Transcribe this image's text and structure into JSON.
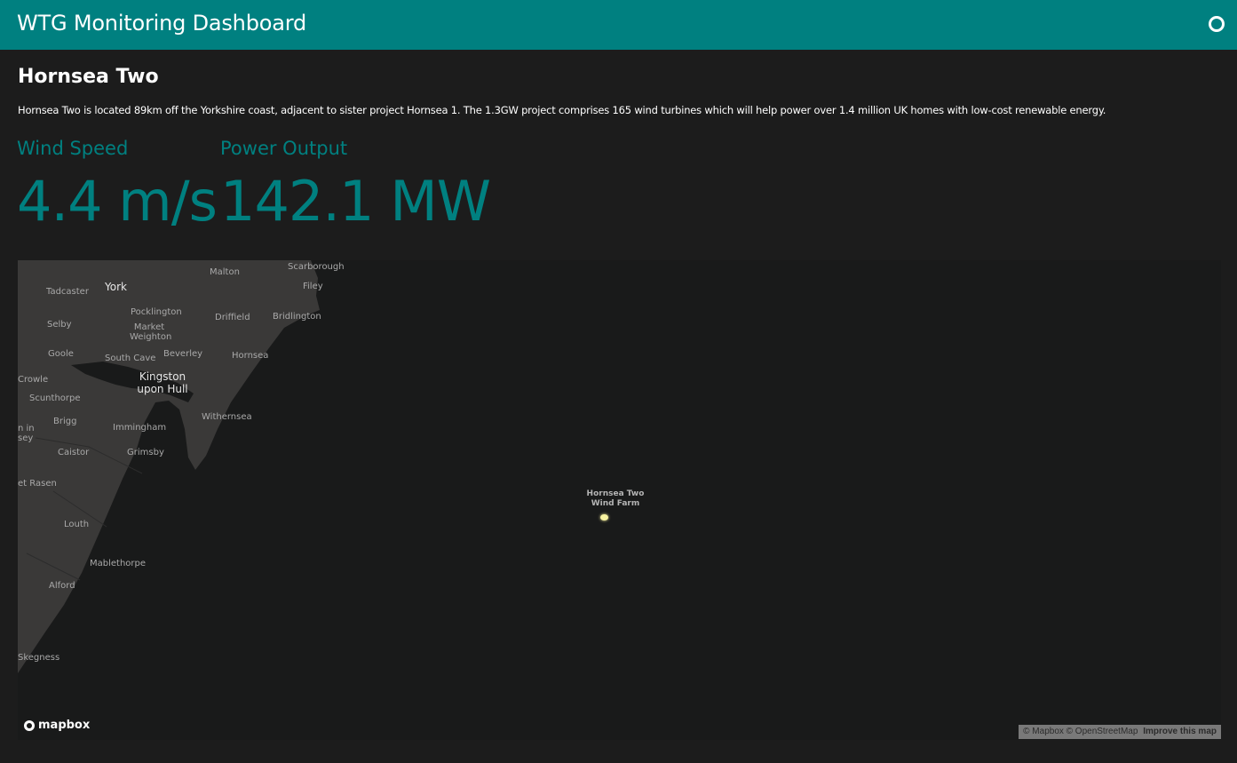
{
  "header": {
    "title": "WTG Monitoring Dashboard",
    "status_icon": "circle-ring-icon"
  },
  "site": {
    "name": "Hornsea Two",
    "description": "Hornsea Two is located 89km off the Yorkshire coast, adjacent to sister project Hornsea 1. The 1.3GW project comprises 165 wind turbines which will help power over 1.4 million UK homes with low-cost renewable energy."
  },
  "metrics": {
    "wind_speed": {
      "label": "Wind Speed",
      "value": "4.4 m/s"
    },
    "power_output": {
      "label": "Power Output",
      "value": "142.1 MW"
    }
  },
  "map": {
    "places": {
      "york": "York",
      "malton": "Malton",
      "scarborough": "Scarborough",
      "filey": "Filey",
      "tadcaster": "Tadcaster",
      "pocklington": "Pocklington",
      "driffield": "Driffield",
      "bridlington": "Bridlington",
      "selby": "Selby",
      "market_weighton": "Market Weighton",
      "goole": "Goole",
      "south_cave": "South Cave",
      "beverley": "Beverley",
      "hornsea": "Hornsea",
      "crowle": "Crowle",
      "kingston": "Kingston upon Hull",
      "scunthorpe": "Scunthorpe",
      "brigg": "Brigg",
      "immingham": "Immingham",
      "withernsea": "Withernsea",
      "caistor": "Caistor",
      "grimsby": "Grimsby",
      "market_rasen": "et Rasen",
      "louth": "Louth",
      "mablethorpe": "Mablethorpe",
      "alford": "Alford",
      "skegness": "Skegness",
      "partial_left": "n in sey"
    },
    "marker_label": "Hornsea Two Wind Farm",
    "marker_color": "#f7f3a1",
    "logo_text": "mapbox",
    "attribution": "© Mapbox © OpenStreetMap",
    "improve_link": "Improve this map"
  },
  "colors": {
    "accent": "#008080",
    "background": "#1c1c1c",
    "land": "#3a3938",
    "water": "#191a1a"
  }
}
